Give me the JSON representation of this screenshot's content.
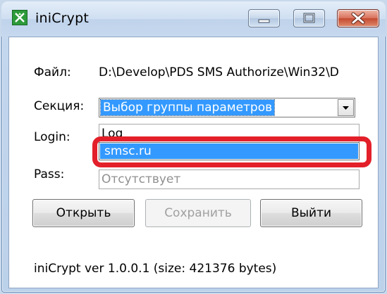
{
  "window": {
    "title": "iniCrypt",
    "icon": "app-crypt-icon",
    "controls": [
      "minimize-icon",
      "maximize-icon",
      "close-icon"
    ]
  },
  "form": {
    "file_label": "Файл:",
    "file_path": "D:\\Develop\\PDS SMS Authorize\\Win32\\D",
    "section_label": "Секция:",
    "section_value": "Выбор группы параметров",
    "login_label": "Login:",
    "login_value": "Log",
    "pass_label": "Pass:",
    "pass_value": "Отсутствует",
    "dropdown_items": [
      "smsc.ru"
    ]
  },
  "buttons": {
    "open": "Открыть",
    "save": "Сохранить",
    "exit": "Выйти"
  },
  "status": {
    "text": "iniCrypt ver 1.0.0.1 (size: 421376 bytes)"
  },
  "colors": {
    "selection": "#3399ff",
    "highlight_annotation": "#e3202a",
    "close_button": "#c44a30"
  }
}
